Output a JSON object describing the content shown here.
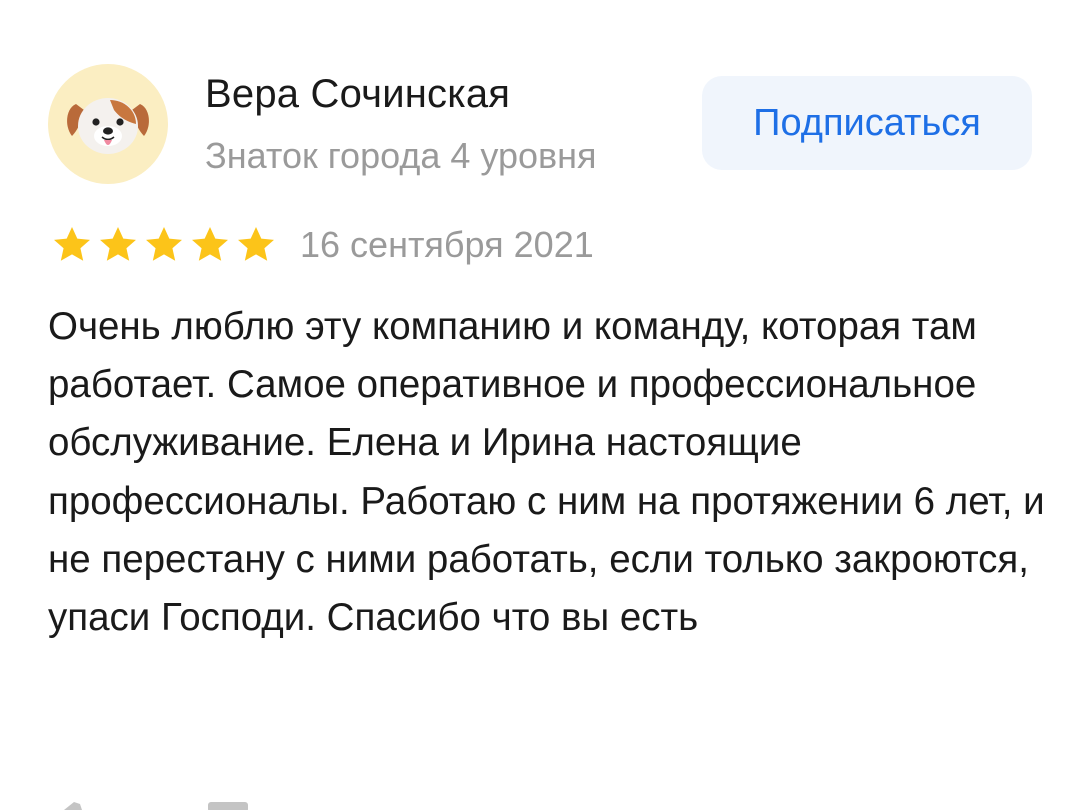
{
  "review": {
    "author": {
      "name": "Вера Сочинская",
      "level": "Знаток города 4 уровня",
      "avatar_icon": "dog-emoji-icon"
    },
    "subscribe_label": "Подписаться",
    "rating": {
      "stars": 5,
      "max_stars": 5,
      "star_color": "#fcc419"
    },
    "date": "16 сентября 2021",
    "text": "Очень люблю эту компанию и команду, которая там работает. Самое оперативное и профессиональное обслуживание. Елена и Ирина настоящие профессионалы. Работаю с ним на протяжении 6 лет, и не перестану с ними работать, если только закроются, упаси Господи. Спасибо что вы есть"
  },
  "colors": {
    "accent": "#1e6fe6",
    "button_bg": "#f0f5fc",
    "muted_text": "#9a9a9a",
    "avatar_bg": "#fbeec2"
  }
}
